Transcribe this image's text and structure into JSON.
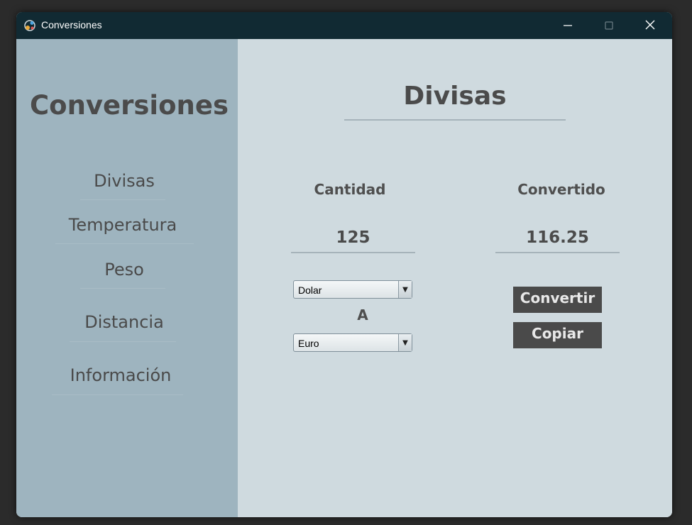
{
  "window": {
    "title": "Conversiones"
  },
  "sidebar": {
    "title": "Conversiones",
    "items": [
      {
        "label": "Divisas"
      },
      {
        "label": "Temperatura"
      },
      {
        "label": "Peso"
      },
      {
        "label": "Distancia"
      },
      {
        "label": "Información"
      }
    ]
  },
  "main": {
    "title": "Divisas",
    "amount_label": "Cantidad",
    "converted_label": "Convertido",
    "amount_value": "125",
    "converted_value": "116.25",
    "from_currency": "Dolar",
    "to_label": "A",
    "to_currency": "Euro",
    "convert_button": "Convertir",
    "copy_button": "Copiar"
  },
  "colors": {
    "titlebar": "#112a33",
    "sidebar": "#9eb4bf",
    "main_bg": "#cfdadf",
    "button_bg": "#4a4a4a",
    "text_dark": "#4b4b4b"
  },
  "icons": {
    "app": "conversions-app-icon",
    "minimize": "minimize-icon",
    "maximize": "maximize-icon",
    "close": "close-icon",
    "dropdown": "dropdown-arrow-icon"
  }
}
